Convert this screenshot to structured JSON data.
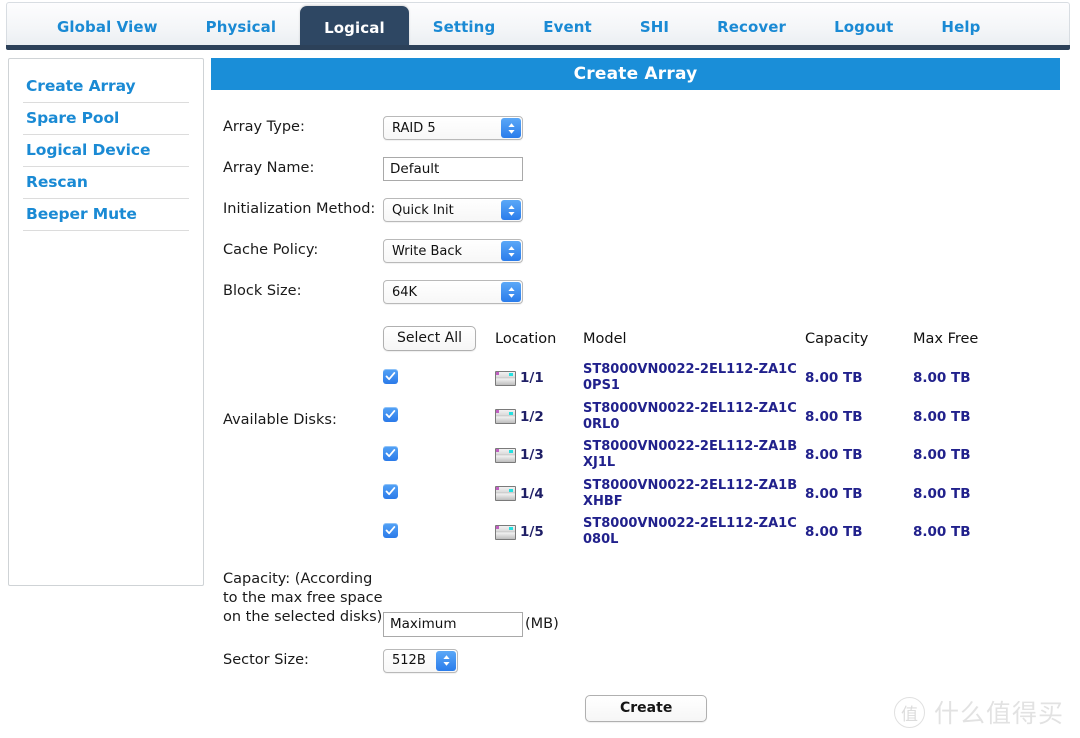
{
  "nav": {
    "tabs": [
      {
        "label": "Global View",
        "active": false
      },
      {
        "label": "Physical",
        "active": false
      },
      {
        "label": "Logical",
        "active": true
      },
      {
        "label": "Setting",
        "active": false
      },
      {
        "label": "Event",
        "active": false
      },
      {
        "label": "SHI",
        "active": false
      },
      {
        "label": "Recover",
        "active": false
      },
      {
        "label": "Logout",
        "active": false
      },
      {
        "label": "Help",
        "active": false
      }
    ]
  },
  "sidebar": {
    "items": [
      {
        "label": "Create Array"
      },
      {
        "label": "Spare Pool"
      },
      {
        "label": "Logical Device"
      },
      {
        "label": "Rescan"
      },
      {
        "label": "Beeper Mute"
      }
    ]
  },
  "panel": {
    "title": "Create Array"
  },
  "form": {
    "array_type": {
      "label": "Array Type:",
      "value": "RAID 5"
    },
    "array_name": {
      "label": "Array Name:",
      "value": "Default",
      "placeholder": ""
    },
    "initialization_method": {
      "label": "Initialization Method:",
      "value": "Quick Init"
    },
    "cache_policy": {
      "label": "Cache Policy:",
      "value": "Write Back"
    },
    "block_size": {
      "label": "Block Size:",
      "value": "64K"
    },
    "available_disks_label": "Available Disks:",
    "capacity": {
      "label": "Capacity: (According to the max free space on the selected disks)",
      "value": "Maximum",
      "unit": "(MB)"
    },
    "sector_size": {
      "label": "Sector Size:",
      "value": "512B"
    },
    "select_all_label": "Select All",
    "create_label": "Create"
  },
  "disk_table": {
    "headers": {
      "location": "Location",
      "model": "Model",
      "capacity": "Capacity",
      "max_free": "Max Free"
    },
    "rows": [
      {
        "checked": true,
        "location": "1/1",
        "model": "ST8000VN0022-2EL112-ZA1C0PS1",
        "capacity": "8.00 TB",
        "max_free": "8.00 TB"
      },
      {
        "checked": true,
        "location": "1/2",
        "model": "ST8000VN0022-2EL112-ZA1C0RL0",
        "capacity": "8.00 TB",
        "max_free": "8.00 TB"
      },
      {
        "checked": true,
        "location": "1/3",
        "model": "ST8000VN0022-2EL112-ZA1BXJ1L",
        "capacity": "8.00 TB",
        "max_free": "8.00 TB"
      },
      {
        "checked": true,
        "location": "1/4",
        "model": "ST8000VN0022-2EL112-ZA1BXHBF",
        "capacity": "8.00 TB",
        "max_free": "8.00 TB"
      },
      {
        "checked": true,
        "location": "1/5",
        "model": "ST8000VN0022-2EL112-ZA1C080L",
        "capacity": "8.00 TB",
        "max_free": "8.00 TB"
      }
    ]
  },
  "watermark": {
    "logo_char": "值",
    "text": "什么值得买"
  },
  "colors": {
    "accent_blue": "#1a8ed8",
    "link_blue": "#1a8ad4",
    "active_tab": "#2e4763",
    "model_navy": "#21218c"
  }
}
